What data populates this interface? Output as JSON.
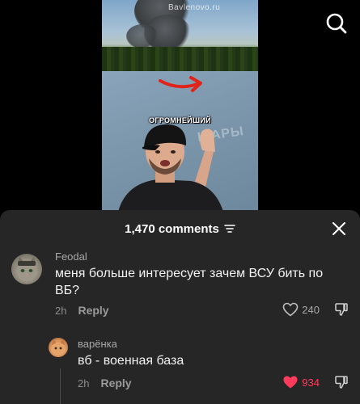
{
  "video": {
    "watermark": "Bavlenovo.ru",
    "caption": "ОГРОМНЕЙШИЙ",
    "background_sign": "ШАРЫ"
  },
  "header": {
    "search_icon": "search-icon"
  },
  "comments_panel": {
    "count_label": "1,470 comments",
    "filter_icon": "filter-icon",
    "close_icon": "close-icon"
  },
  "comments": [
    {
      "username": "Feodal",
      "text": "меня больше интересует зачем ВСУ бить по ВБ?",
      "time": "2h",
      "reply_label": "Reply",
      "likes": "240",
      "liked": false
    },
    {
      "username": "варёнка",
      "text": "вб - военная база",
      "time": "2h",
      "reply_label": "Reply",
      "likes": "934",
      "liked": true
    }
  ],
  "colors": {
    "sheet_bg": "#262626",
    "liked_heart": "#ff3b5c",
    "muted_text": "#8c8c8c"
  }
}
